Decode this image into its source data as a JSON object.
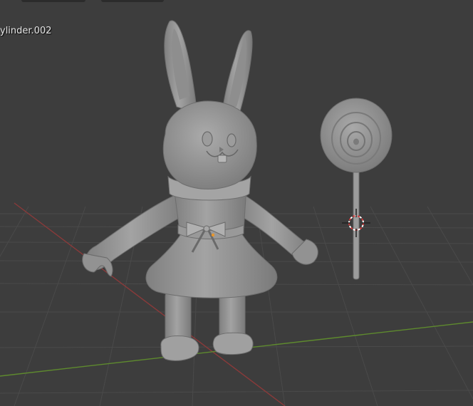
{
  "viewport": {
    "object_name": "ylinder.002",
    "background": "#3d3d3d",
    "grid_color": "#4a4a4a",
    "x_axis_color": "#8a3a3a",
    "y_axis_color": "#5e8a2e",
    "model_color": "#9a9a9a",
    "cursor_colors": [
      "#d23a3a",
      "#ffffff"
    ]
  },
  "scene": {
    "objects": [
      "rabbit-mesh",
      "lollipop-mesh"
    ],
    "tool": "3d-cursor-icon"
  }
}
